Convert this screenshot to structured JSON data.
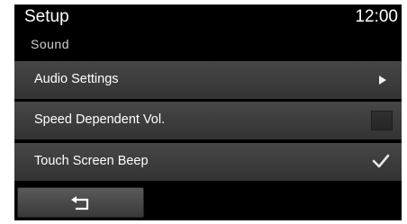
{
  "header": {
    "title": "Setup",
    "clock": "12:00"
  },
  "breadcrumb": "Sound",
  "menu": {
    "items": [
      {
        "label": "Audio Settings",
        "control": "arrow-right-icon"
      },
      {
        "label": "Speed Dependent Vol.",
        "control": "checkbox",
        "checked": false
      },
      {
        "label": "Touch Screen Beep",
        "control": "checkbox",
        "checked": true
      }
    ]
  },
  "footer": {
    "back_icon": "back-arrow-icon"
  }
}
